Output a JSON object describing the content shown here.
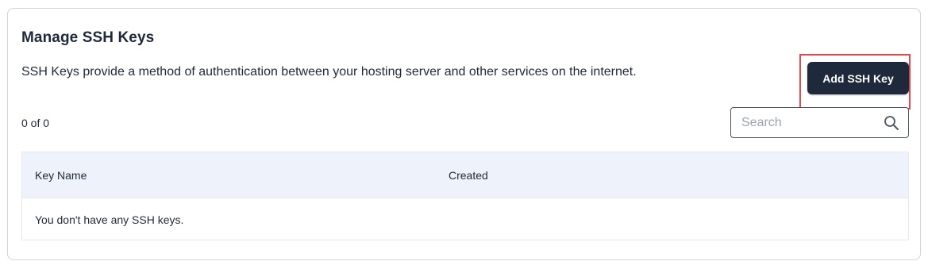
{
  "section": {
    "title": "Manage SSH Keys",
    "description": "SSH Keys provide a method of authentication between your hosting server and other services on the internet.",
    "add_button_label": "Add SSH Key",
    "count_label": "0 of 0"
  },
  "search": {
    "placeholder": "Search",
    "value": "",
    "icon": "search-icon"
  },
  "table": {
    "columns": [
      "Key Name",
      "Created"
    ],
    "empty_message": "You don't have any SSH keys."
  },
  "colors": {
    "primary_button": "#1e293b",
    "highlight_border": "#e5484d",
    "table_header_bg": "#edf2fb"
  }
}
